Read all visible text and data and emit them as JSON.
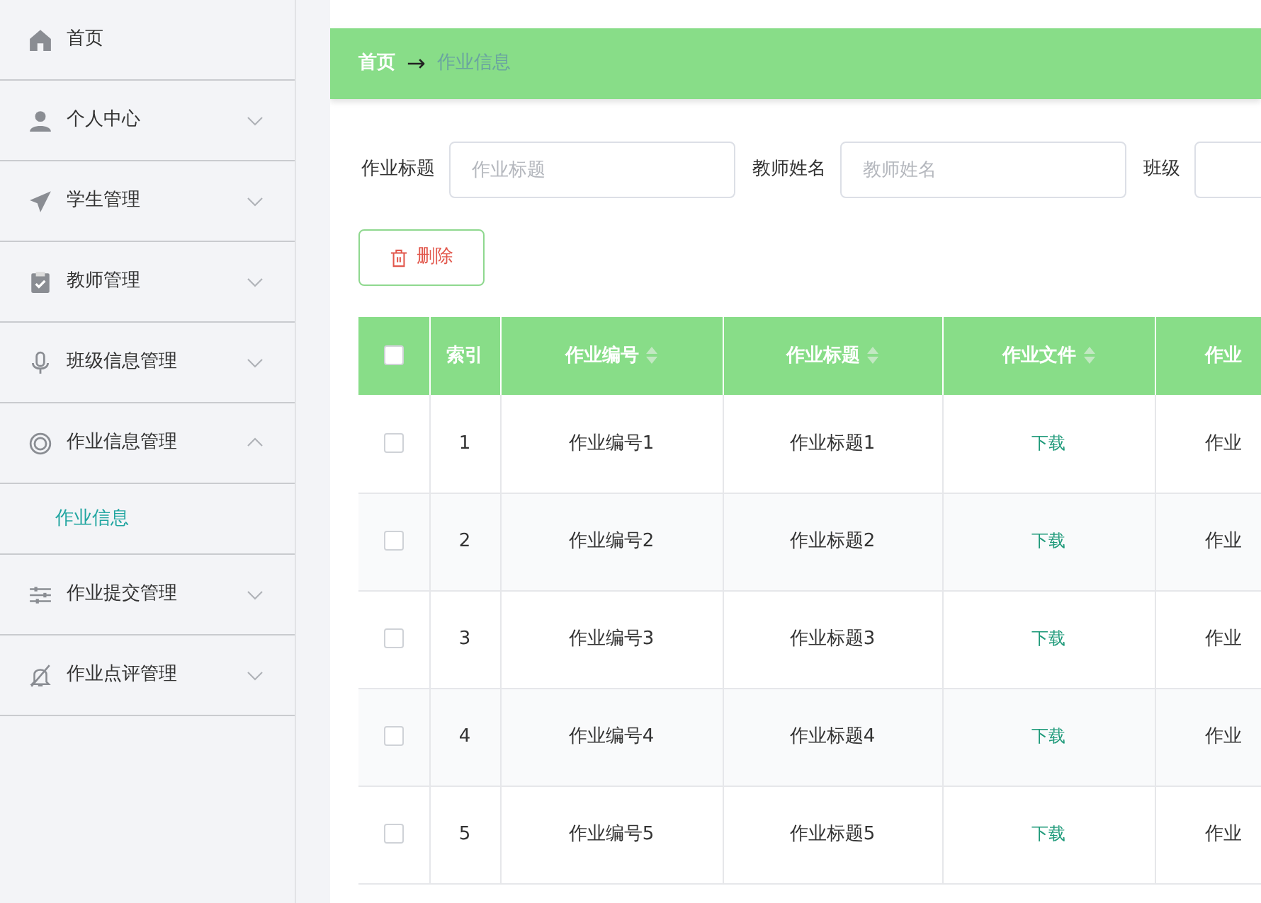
{
  "sidebar": {
    "items": [
      {
        "label": "首页"
      },
      {
        "label": "个人中心",
        "expanded": false
      },
      {
        "label": "学生管理",
        "expanded": false
      },
      {
        "label": "教师管理",
        "expanded": false
      },
      {
        "label": "班级信息管理",
        "expanded": false
      },
      {
        "label": "作业信息管理",
        "expanded": true,
        "children": [
          {
            "label": "作业信息",
            "selected": true
          }
        ]
      },
      {
        "label": "作业提交管理",
        "expanded": false
      },
      {
        "label": "作业点评管理",
        "expanded": false
      }
    ]
  },
  "breadcrumb": {
    "home": "首页",
    "separator": "→",
    "current": "作业信息"
  },
  "filters": [
    {
      "label": "作业标题",
      "placeholder": "作业标题"
    },
    {
      "label": "教师姓名",
      "placeholder": "教师姓名"
    },
    {
      "label": "班级"
    }
  ],
  "delete_button": "删除",
  "table": {
    "select_all_checked": false,
    "columns": [
      {
        "label": "索引",
        "sortable": false
      },
      {
        "label": "作业编号",
        "sortable": true
      },
      {
        "label": "作业标题",
        "sortable": true
      },
      {
        "label": "作业文件",
        "sortable": true
      },
      {
        "label": "作业",
        "sortable": false
      }
    ],
    "rows": [
      {
        "checked": false,
        "cells": [
          "1",
          "作业编号1",
          "作业标题1",
          "下载",
          "作业"
        ]
      },
      {
        "checked": false,
        "cells": [
          "2",
          "作业编号2",
          "作业标题2",
          "下载",
          "作业"
        ]
      },
      {
        "checked": false,
        "cells": [
          "3",
          "作业编号3",
          "作业标题3",
          "下载",
          "作业"
        ]
      },
      {
        "checked": false,
        "cells": [
          "4",
          "作业编号4",
          "作业标题4",
          "下载",
          "作业"
        ]
      },
      {
        "checked": false,
        "cells": [
          "5",
          "作业编号5",
          "作业标题5",
          "下载",
          "作业"
        ]
      }
    ]
  }
}
